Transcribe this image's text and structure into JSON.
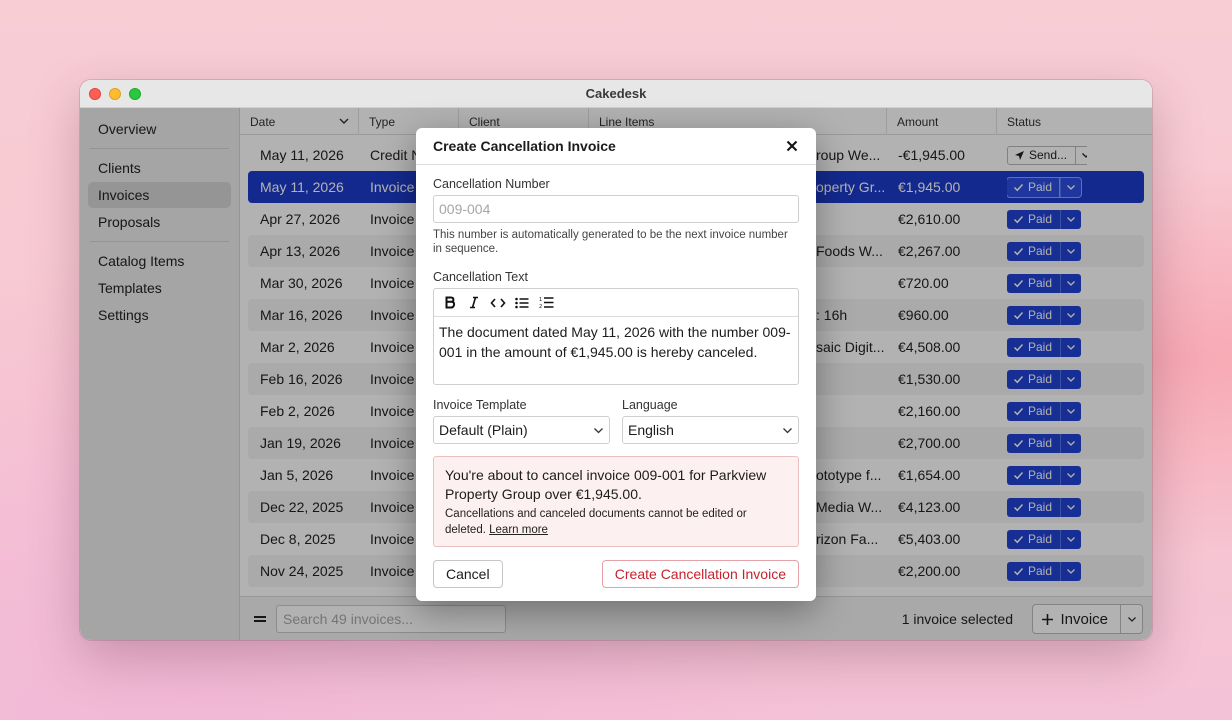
{
  "app": {
    "title": "Cakedesk"
  },
  "sidebar": {
    "groups": [
      [
        {
          "label": "Overview",
          "active": false
        }
      ],
      [
        {
          "label": "Clients",
          "active": false
        },
        {
          "label": "Invoices",
          "active": true
        },
        {
          "label": "Proposals",
          "active": false
        }
      ],
      [
        {
          "label": "Catalog Items",
          "active": false
        },
        {
          "label": "Templates",
          "active": false
        },
        {
          "label": "Settings",
          "active": false
        }
      ]
    ]
  },
  "table": {
    "columns": [
      "Date",
      "Type",
      "Client",
      "Line Items",
      "Amount",
      "Status"
    ],
    "rows": [
      {
        "date": "May 11, 2026",
        "type": "Credit N",
        "line": "roup We...",
        "amount": "-€1,945.00",
        "status": "Send...",
        "kind": "send"
      },
      {
        "date": "May 11, 2026",
        "type": "Invoice",
        "line": "operty Gr...",
        "amount": "€1,945.00",
        "status": "Paid",
        "kind": "paid",
        "selected": true
      },
      {
        "date": "Apr 27, 2026",
        "type": "Invoice",
        "line": "",
        "amount": "€2,610.00",
        "status": "Paid",
        "kind": "paid"
      },
      {
        "date": "Apr 13, 2026",
        "type": "Invoice",
        "line": "Foods W...",
        "amount": "€2,267.00",
        "status": "Paid",
        "kind": "paid"
      },
      {
        "date": "Mar 30, 2026",
        "type": "Invoice",
        "line": "",
        "amount": "€720.00",
        "status": "Paid",
        "kind": "paid"
      },
      {
        "date": "Mar 16, 2026",
        "type": "Invoice",
        "line": ": 16h",
        "amount": "€960.00",
        "status": "Paid",
        "kind": "paid"
      },
      {
        "date": "Mar 2, 2026",
        "type": "Invoice",
        "line": "saic Digit...",
        "amount": "€4,508.00",
        "status": "Paid",
        "kind": "paid"
      },
      {
        "date": "Feb 16, 2026",
        "type": "Invoice",
        "line": "",
        "amount": "€1,530.00",
        "status": "Paid",
        "kind": "paid"
      },
      {
        "date": "Feb 2, 2026",
        "type": "Invoice",
        "line": "",
        "amount": "€2,160.00",
        "status": "Paid",
        "kind": "paid"
      },
      {
        "date": "Jan 19, 2026",
        "type": "Invoice",
        "line": "",
        "amount": "€2,700.00",
        "status": "Paid",
        "kind": "paid"
      },
      {
        "date": "Jan 5, 2026",
        "type": "Invoice",
        "line": "ototype f...",
        "amount": "€1,654.00",
        "status": "Paid",
        "kind": "paid"
      },
      {
        "date": "Dec 22, 2025",
        "type": "Invoice",
        "line": "Media W...",
        "amount": "€4,123.00",
        "status": "Paid",
        "kind": "paid"
      },
      {
        "date": "Dec 8, 2025",
        "type": "Invoice",
        "line": "rizon Fa...",
        "amount": "€5,403.00",
        "status": "Paid",
        "kind": "paid"
      },
      {
        "date": "Nov 24, 2025",
        "type": "Invoice",
        "line": "",
        "amount": "€2,200.00",
        "status": "Paid",
        "kind": "paid"
      }
    ]
  },
  "footer": {
    "search_placeholder": "Search 49 invoices...",
    "selection_text": "1 invoice selected",
    "new_button": "Invoice"
  },
  "modal": {
    "title": "Create Cancellation Invoice",
    "number_label": "Cancellation Number",
    "number_placeholder": "009-004",
    "number_help": "This number is automatically generated to be the next invoice number in sequence.",
    "text_label": "Cancellation Text",
    "text_value": "The document dated May 11, 2026 with the number 009-001 in the amount of €1,945.00 is hereby canceled.",
    "template_label": "Invoice Template",
    "template_value": "Default (Plain)",
    "language_label": "Language",
    "language_value": "English",
    "warning_main": "You're about to cancel invoice 009-001 for Parkview Property Group over €1,945.00.",
    "warning_sub": "Cancellations and canceled documents cannot be edited or deleted.",
    "warning_link": "Learn more",
    "cancel_button": "Cancel",
    "confirm_button": "Create Cancellation Invoice"
  },
  "colors": {
    "accent": "#2144d6",
    "selection": "#1e3ccc",
    "danger": "#c8202d",
    "warning_bg": "#fdf0f0"
  }
}
